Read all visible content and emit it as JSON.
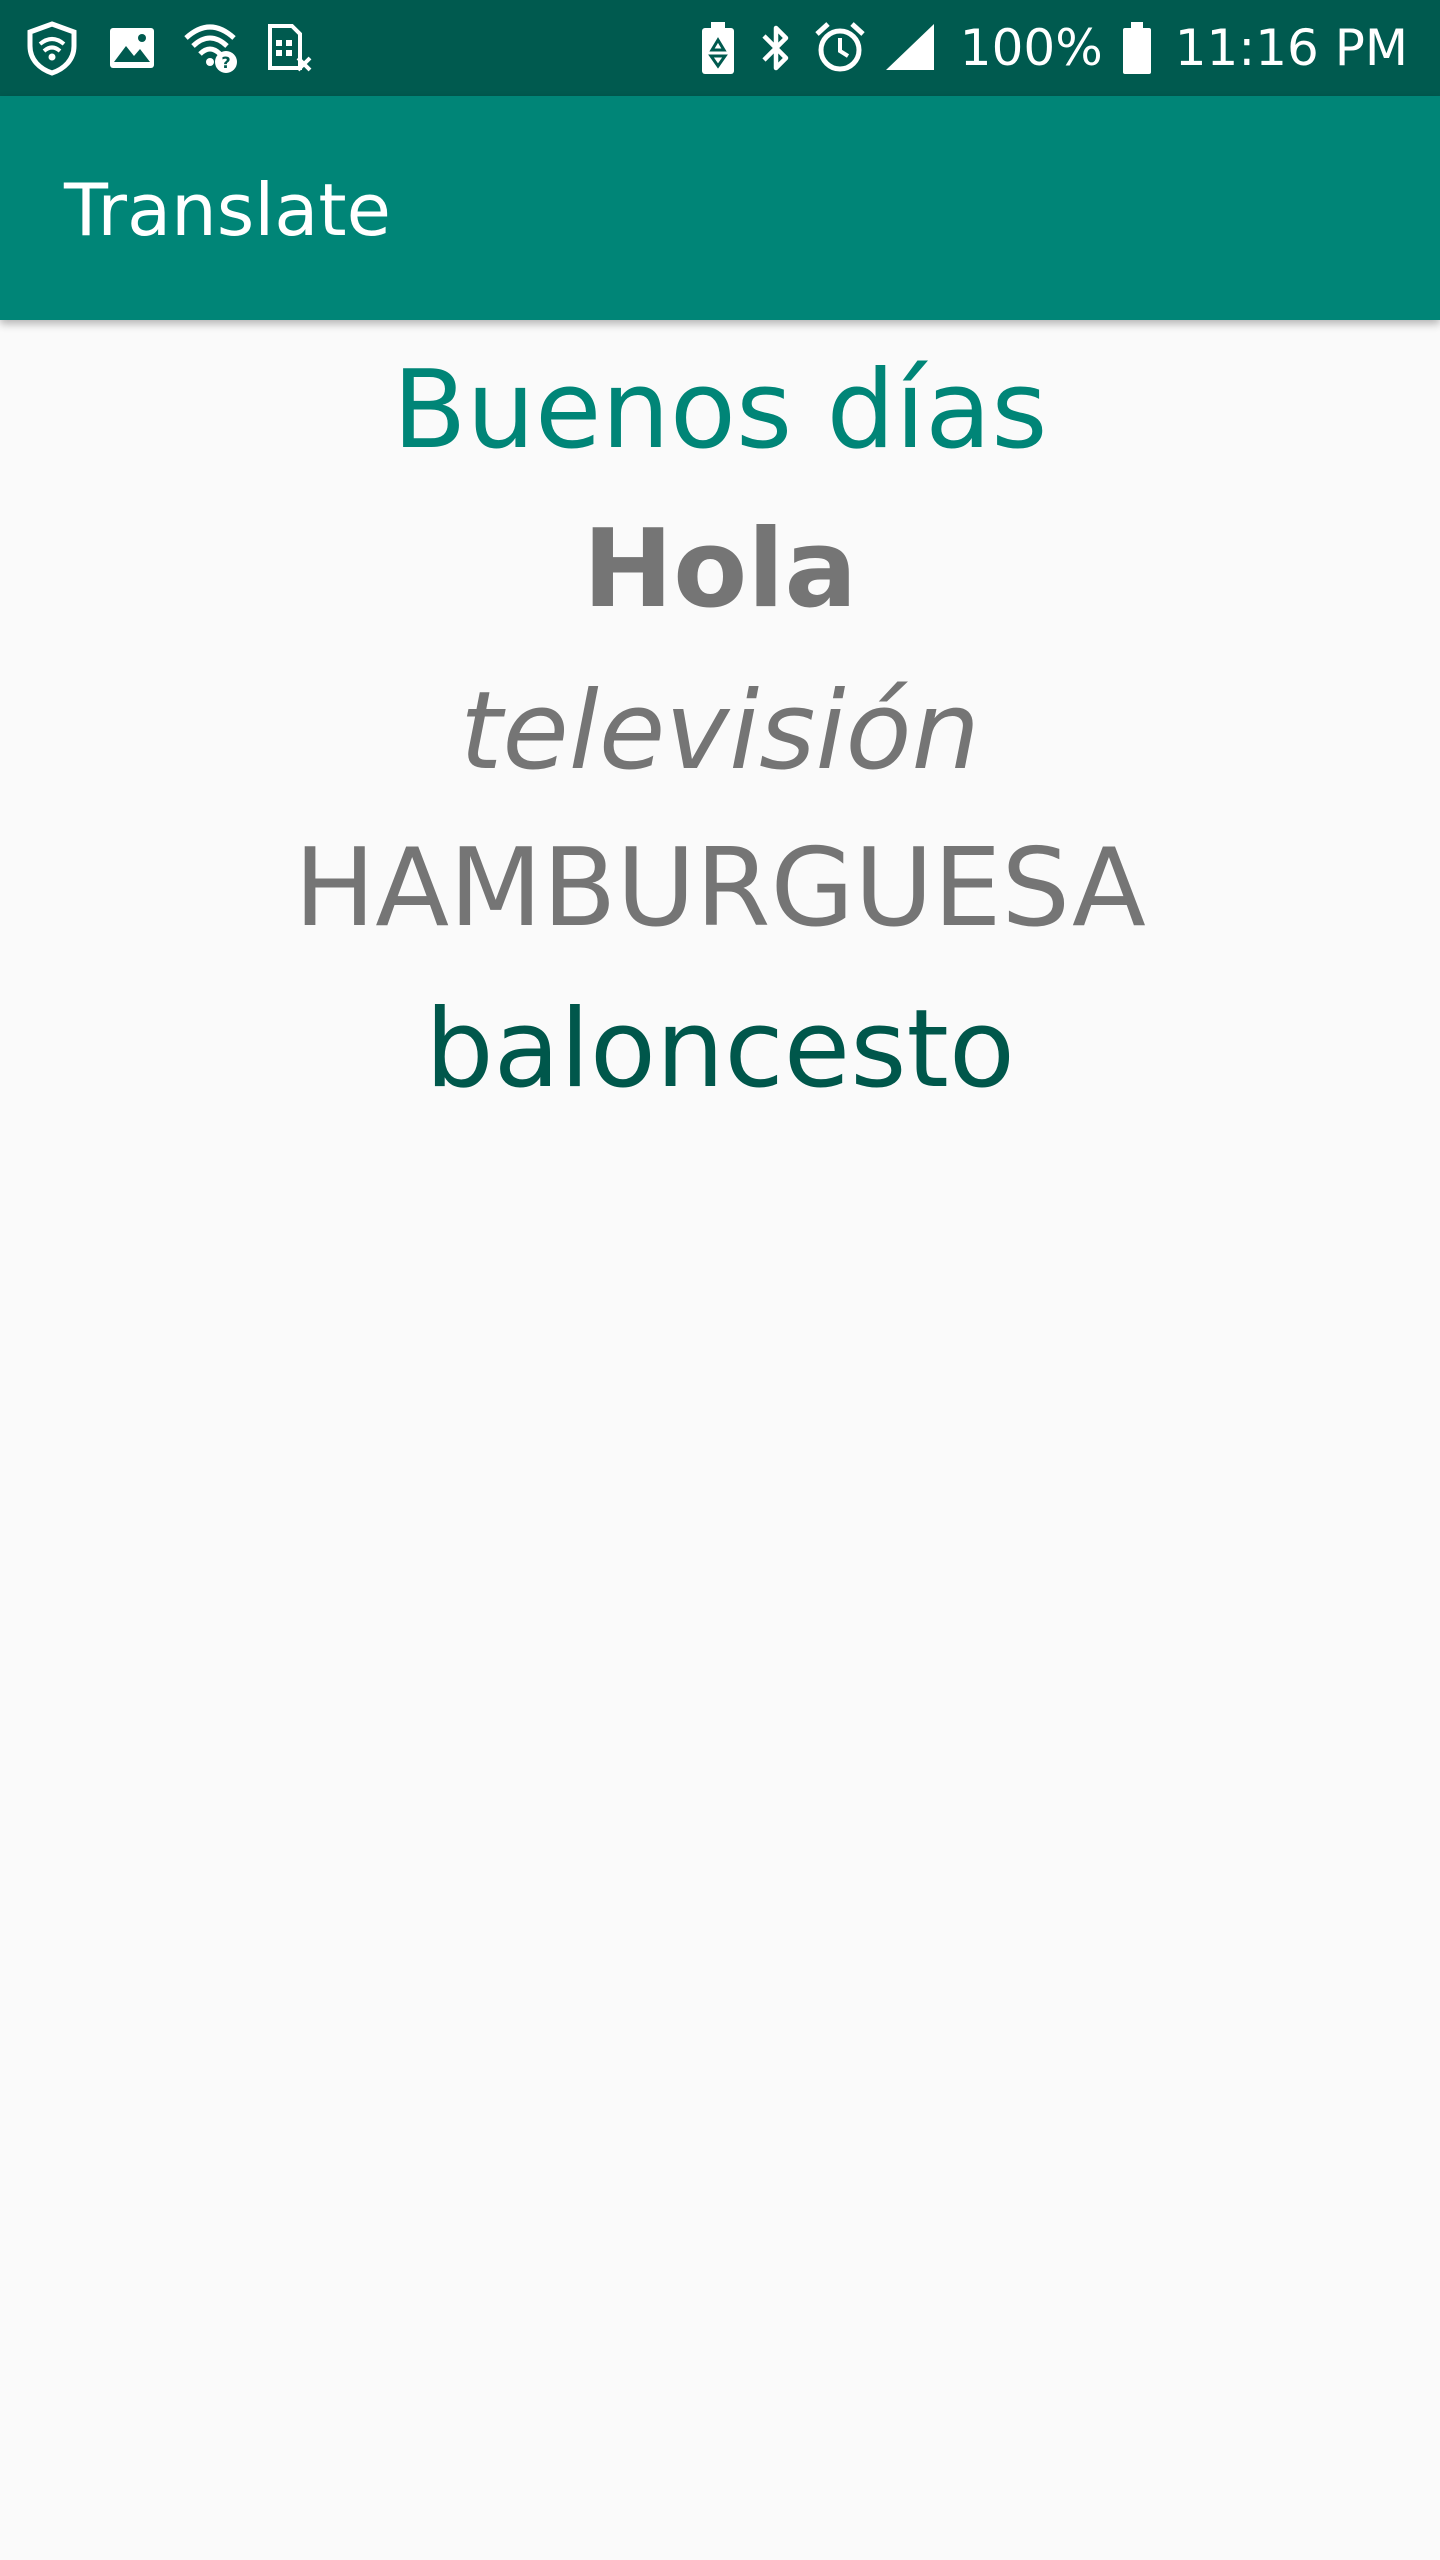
{
  "status_bar": {
    "left_icons": [
      "shield-icon",
      "image-icon",
      "wifi-question-icon",
      "sim-error-icon"
    ],
    "right_icons": [
      "battery-saver-icon",
      "bluetooth-icon",
      "alarm-icon",
      "signal-icon"
    ],
    "battery_percent": "100%",
    "time": "11:16 PM"
  },
  "app_bar": {
    "title": "Translate"
  },
  "words": [
    {
      "text": "Buenos días",
      "color": "#008577",
      "style": "normal"
    },
    {
      "text": "Hola",
      "color": "#757575",
      "style": "bold"
    },
    {
      "text": "televisión",
      "color": "#757575",
      "style": "italic"
    },
    {
      "text": "HAMBURGUESA",
      "color": "#757575",
      "style": "all-caps"
    },
    {
      "text": "baloncesto",
      "color": "#00574b",
      "style": "normal"
    }
  ],
  "colors": {
    "status_bar": "#005a4f",
    "primary": "#008577",
    "primary_dark": "#00574b",
    "text_gray": "#757575",
    "background": "#fafafa"
  }
}
